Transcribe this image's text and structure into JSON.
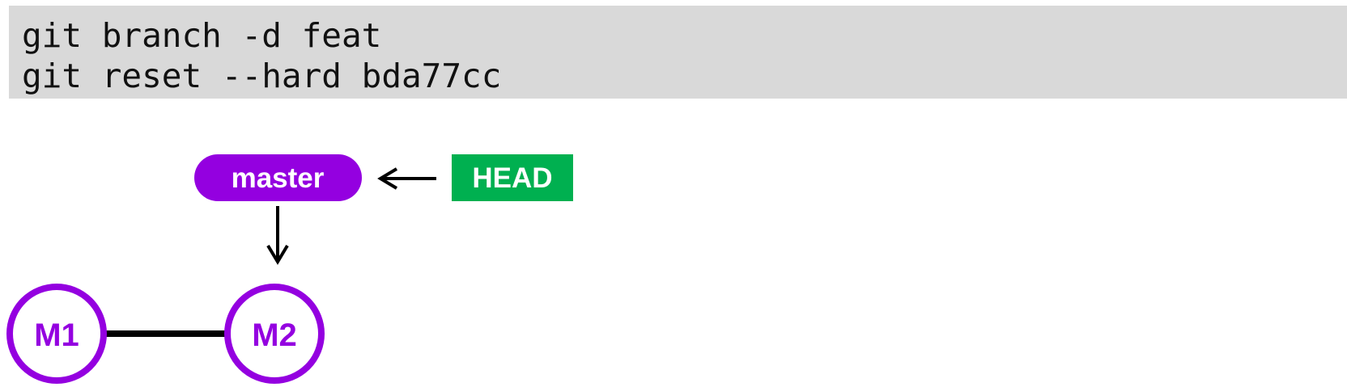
{
  "code": {
    "lines": [
      "git branch -d feat",
      "git reset --hard bda77cc"
    ]
  },
  "diagram": {
    "branch_label": "master",
    "head_label": "HEAD",
    "commits": [
      "M1",
      "M2"
    ],
    "colors": {
      "commit": "#9400e0",
      "branch": "#9400e0",
      "head": "#00b050",
      "edge": "#000000"
    }
  }
}
